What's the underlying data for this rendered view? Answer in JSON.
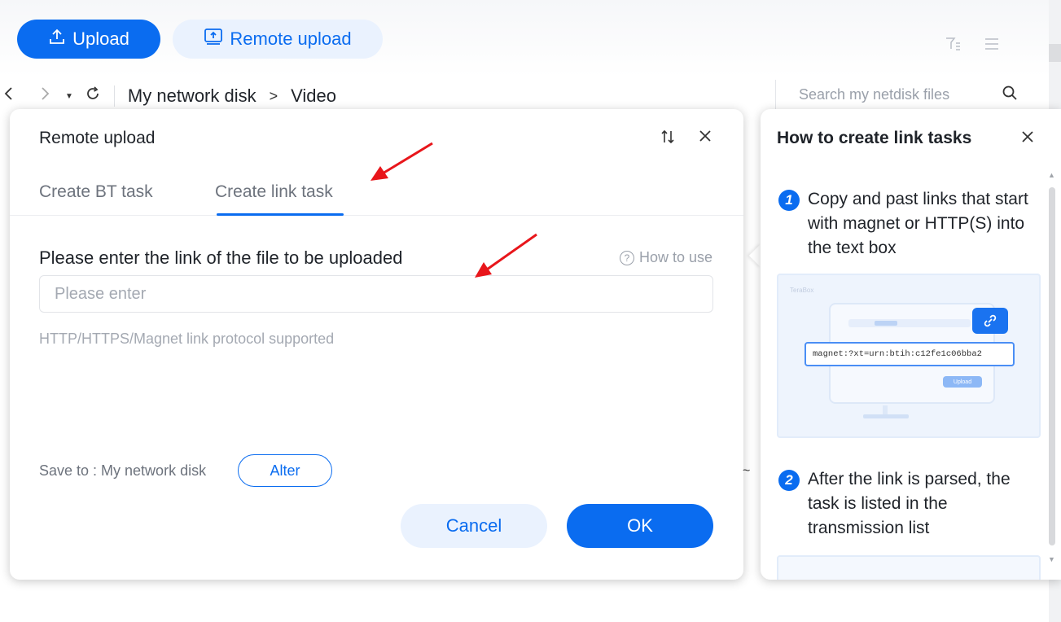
{
  "toolbar": {
    "upload_label": "Upload",
    "remote_upload_label": "Remote upload"
  },
  "breadcrumb": {
    "root": "My network disk",
    "separator": ">",
    "current": "Video"
  },
  "search": {
    "placeholder": "Search my netdisk files"
  },
  "dialog": {
    "title": "Remote upload",
    "tabs": [
      {
        "label": "Create BT task",
        "active": false
      },
      {
        "label": "Create link task",
        "active": true
      }
    ],
    "field_label": "Please enter the link of the file to be uploaded",
    "how_to_use": "How to use",
    "input_placeholder": "Please enter",
    "hint": "HTTP/HTTPS/Magnet link protocol supported",
    "save_to": "Save to : My network disk",
    "alter_label": "Alter",
    "cancel_label": "Cancel",
    "ok_label": "OK"
  },
  "help_panel": {
    "title": "How to create link tasks",
    "steps": [
      {
        "num": "1",
        "text": "Copy and past links that start with magnet or HTTP(S) into the text box"
      },
      {
        "num": "2",
        "text": "After the link is parsed, the task is listed in the transmission list"
      }
    ],
    "illustration": {
      "brand": "TeraBox",
      "magnet_text": "magnet:?xt=urn:btih:c12fe1c06bba2",
      "upload_label": "Upload"
    }
  },
  "colors": {
    "accent": "#0a6cf0",
    "annotation_arrow": "#e8161b"
  }
}
